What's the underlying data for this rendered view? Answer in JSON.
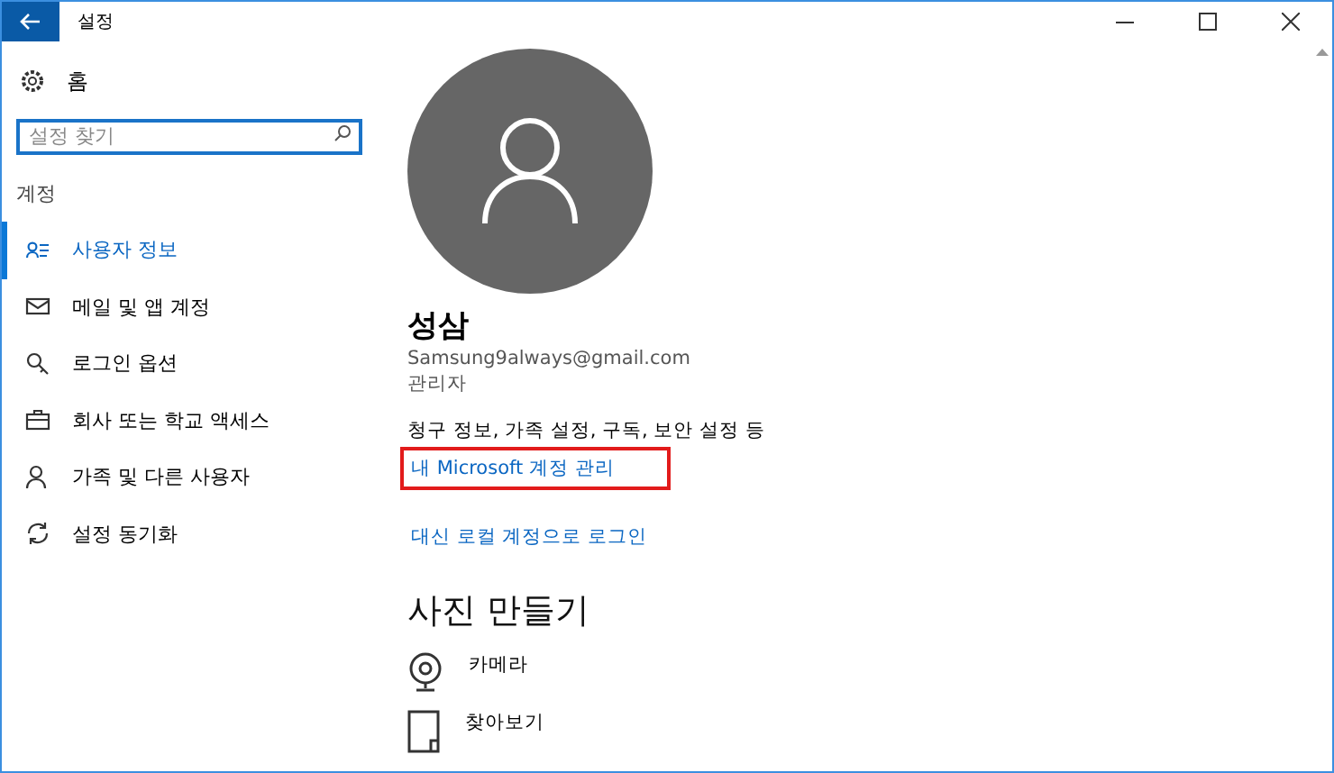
{
  "window": {
    "title": "설정"
  },
  "sidebar": {
    "home": "홈",
    "search": {
      "placeholder": "설정 찾기"
    },
    "section": "계정",
    "items": [
      {
        "label": "사용자 정보",
        "kind": "user-info",
        "selected": true
      },
      {
        "label": "메일 및 앱 계정",
        "kind": "mail",
        "selected": false
      },
      {
        "label": "로그인 옵션",
        "kind": "key",
        "selected": false
      },
      {
        "label": "회사 또는 학교 액세스",
        "kind": "briefcase",
        "selected": false
      },
      {
        "label": "가족 및 다른 사용자",
        "kind": "person",
        "selected": false
      },
      {
        "label": "설정 동기화",
        "kind": "sync",
        "selected": false
      }
    ]
  },
  "profile": {
    "name": "성삼",
    "email": "Samsung9always@gmail.com",
    "role": "관리자",
    "description": "청구 정보, 가족 설정, 구독, 보안 설정 등",
    "links": [
      {
        "label": "내 Microsoft 계정 관리",
        "highlighted": true
      },
      {
        "label": "대신 로컬 계정으로 로그인",
        "highlighted": false
      }
    ]
  },
  "photo": {
    "heading": "사진 만들기",
    "options": [
      {
        "label": "카메라",
        "kind": "camera"
      },
      {
        "label": "찾아보기",
        "kind": "browse"
      }
    ]
  }
}
